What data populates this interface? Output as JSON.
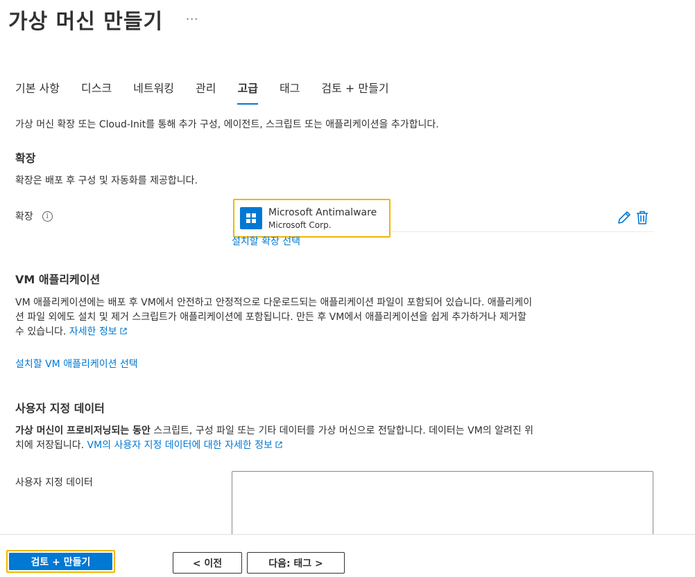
{
  "header": {
    "title": "가상 머신 만들기",
    "more": "···"
  },
  "tabs": [
    {
      "label": "기본 사항",
      "active": false
    },
    {
      "label": "디스크",
      "active": false
    },
    {
      "label": "네트워킹",
      "active": false
    },
    {
      "label": "관리",
      "active": false
    },
    {
      "label": "고급",
      "active": true
    },
    {
      "label": "태그",
      "active": false
    },
    {
      "label": "검토 + 만들기",
      "active": false
    }
  ],
  "intro": "가상 머신 확장 또는 Cloud-Init를 통해 추가 구성, 에이전트, 스크립트 또는 애플리케이션을 추가합니다.",
  "extensions": {
    "heading": "확장",
    "description": "확장은 배포 후 구성 및 자동화를 제공합니다.",
    "field_label": "확장",
    "info_icon": "i",
    "selected": {
      "name": "Microsoft Antimalware",
      "publisher": "Microsoft Corp."
    },
    "select_link": "설치할 확장 선택"
  },
  "vm_apps": {
    "heading": "VM 애플리케이션",
    "description_line1": "VM 애플리케이션에는 배포 후 VM에서 안전하고 안정적으로 다운로드되는 애플리케이션 파일이 포함되어 있습니다. 애플리케이",
    "description_line2": "션 파일 외에도 설치 및 제거 스크립트가 애플리케이션에 포함됩니다. 만든 후 VM에서 애플리케이션을 쉽게 추가하거나 제거할",
    "description_line3": "수 있습니다.",
    "learn_more": "자세한 정보",
    "select_link": "설치할 VM 애플리케이션 선택"
  },
  "custom_data": {
    "heading": "사용자 지정 데이터",
    "desc_bold": "가상 머신이 프로비저닝되는 동안",
    "desc_rest": " 스크립트, 구성 파일 또는 기타 데이터를 가상 머신으로 전달합니다. 데이터는 VM의 알려진 위",
    "desc_line2": "치에 저장됩니다.",
    "learn_more": "VM의 사용자 지정 데이터에 대한 자세한 정보",
    "field_label": "사용자 지정 데이터",
    "value": ""
  },
  "footer": {
    "review_create": "검토 + 만들기",
    "previous": "< 이전",
    "next": "다음: 태그 >"
  },
  "colors": {
    "accent": "#0078d4",
    "highlight": "#f2b600",
    "text": "#323130"
  }
}
